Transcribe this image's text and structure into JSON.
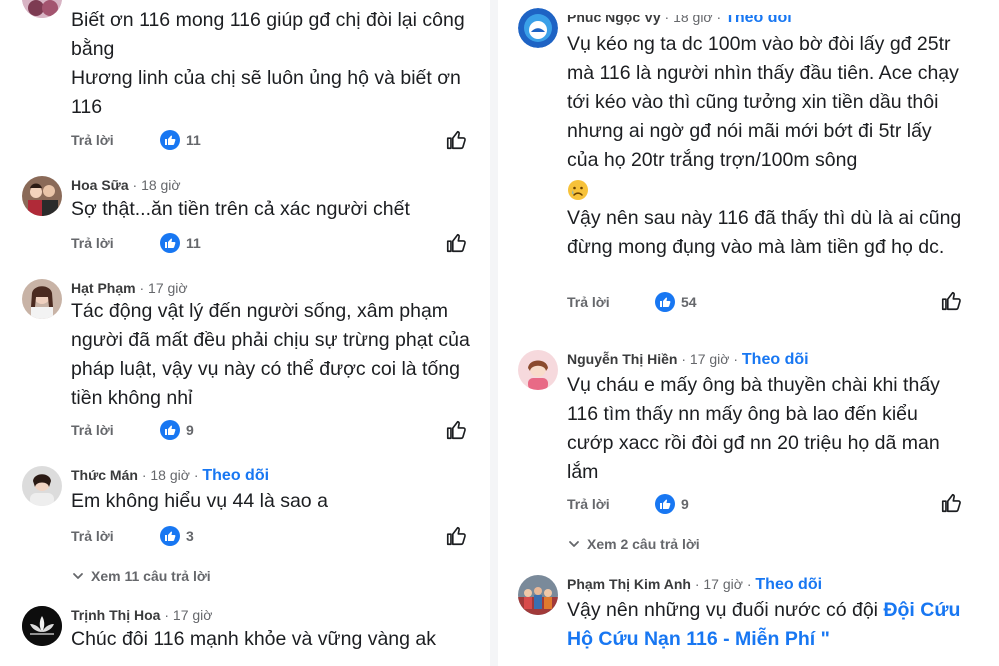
{
  "labels": {
    "reply": "Trả lời",
    "follow": "Theo dõi",
    "separator": "·"
  },
  "left": {
    "comments": [
      {
        "lines": [
          "Biết ơn 116  mong 116 giúp gđ chị đòi lại công bằng",
          "Hương linh của chị sẽ luôn ủng hộ và biết ơn 116"
        ],
        "likes": "11"
      },
      {
        "name": "Hoa Sữa",
        "time": "18 giờ",
        "text": "Sợ thật...ăn tiền trên cả xác người chết",
        "likes": "11"
      },
      {
        "name": "Hạt Phạm",
        "time": "17 giờ",
        "text": "Tác động vật lý đến người sống, xâm phạm người đã mất đều phải chịu sự trừng phạt của pháp luật, vậy vụ này có thể được coi là tống tiền không nhỉ",
        "likes": "9"
      },
      {
        "name": "Thức Mán",
        "time": "18 giờ",
        "text": "Em không hiểu vụ 44 là sao a",
        "likes": "3",
        "more_replies": "Xem 11 câu trả lời"
      },
      {
        "name": "Trịnh Thị Hoa",
        "time": "17 giờ",
        "text": "Chúc đôi 116 mạnh khỏe và vững vàng ak"
      }
    ]
  },
  "right": {
    "comments": [
      {
        "name": "Phúc Ngọc Vy",
        "time": "18 giờ",
        "text": "Vụ kéo ng ta dc 100m vào bờ đòi lấy gđ 25tr mà 116 là người nhìn thấy đầu tiên. Ace chạy tới kéo vào thì cũng tưởng xin tiền dầu thôi nhưng ai ngờ gđ nói mãi mới bớt đi 5tr lấy của họ 20tr trắng trợn/100m sông",
        "text2": "Vậy nên sau này 116 đã thấy thì dù là ai cũng đừng mong đụng vào mà làm tiền gđ họ dc.",
        "likes": "54"
      },
      {
        "name": "Nguyễn Thị Hiền",
        "time": "17 giờ",
        "text": "Vụ cháu e mấy ông bà thuyền chài khi thấy 116 tìm thấy nn mấy ông bà lao đến kiểu cướp xacc rồi đòi gđ nn 20 triệu họ dã man lắm",
        "likes": "9",
        "more_replies": "Xem 2 câu trả lời"
      },
      {
        "name": "Phạm Thị Kim Anh",
        "time": "17 giờ",
        "text": "Vậy nên những vụ đuối nước có đội ",
        "link": "Đội Cứu Hộ Cứu Nạn 116 - Miễn Phí",
        "tail": " \""
      }
    ]
  }
}
